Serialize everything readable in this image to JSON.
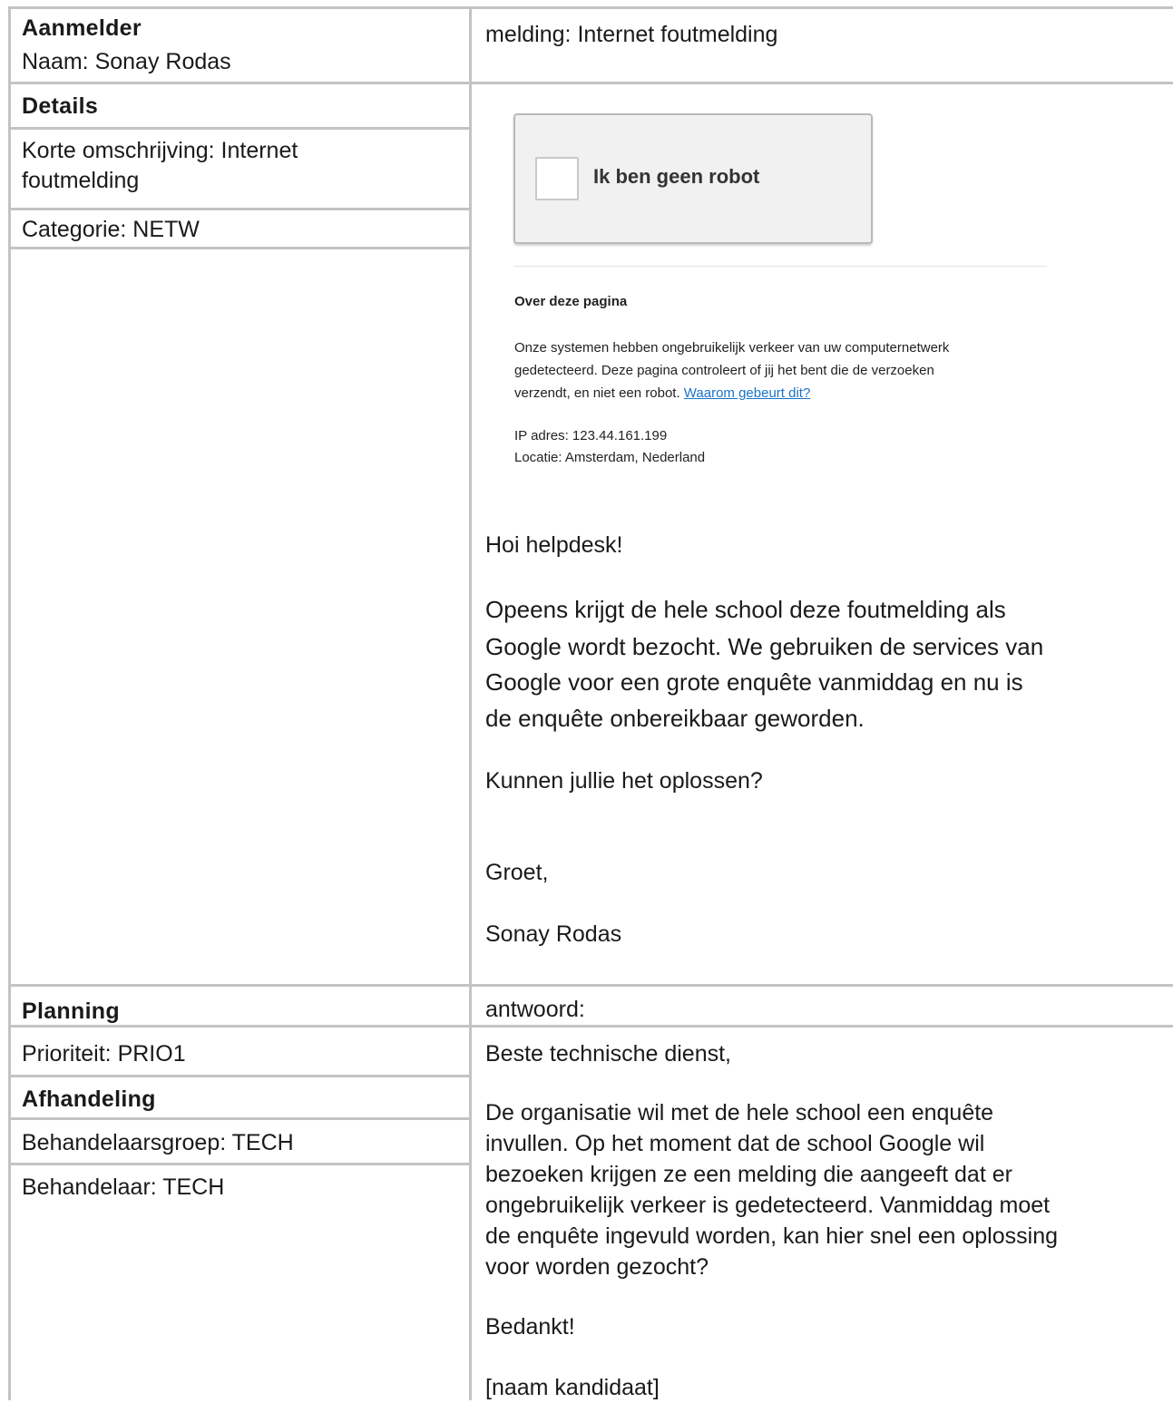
{
  "reporter": {
    "heading": "Aanmelder",
    "name_line": "Naam: Sonay Rodas"
  },
  "ticket": {
    "subject": "melding: Internet foutmelding"
  },
  "details": {
    "heading": "Details",
    "short_description": "Korte omschrijving: Internet foutmelding",
    "category": "Categorie: NETW"
  },
  "screenshot": {
    "checkbox_label": "Ik ben geen robot",
    "about_heading": "Over deze pagina",
    "about_line1": "Onze systemen hebben ongebruikelijk verkeer van uw computernetwerk",
    "about_line2": "gedetecteerd. Deze pagina controleert of jij het bent die de verzoeken",
    "about_line3": "verzendt, en niet een robot.",
    "about_link": "Waarom gebeurt dit?",
    "ip": "IP adres: 123.44.161.199",
    "location": "Locatie: Amsterdam, Nederland"
  },
  "message": {
    "greeting": "Hoi helpdesk!",
    "body_l1": "Opeens krijgt de hele school deze foutmelding als",
    "body_l2": "Google wordt bezocht. We gebruiken de services van",
    "body_l3": "Google voor een grote enquête vanmiddag en nu is",
    "body_l4": "de enquête onbereikbaar geworden.",
    "question": "Kunnen jullie het oplossen?",
    "closing": "Groet,",
    "signature": "Sonay Rodas"
  },
  "planning": {
    "heading": "Planning",
    "priority": "Prioriteit: PRIO1"
  },
  "handling": {
    "heading": "Afhandeling",
    "group": "Behandelaarsgroep: TECH",
    "handler": "Behandelaar: TECH"
  },
  "answer": {
    "label": "antwoord:",
    "salutation": "Beste technische dienst,",
    "body_l1": "De organisatie wil met de hele school een enquête",
    "body_l2": "invullen. Op het moment dat de school Google wil",
    "body_l3": "bezoeken krijgen ze een melding die aangeeft dat er",
    "body_l4": "ongebruikelijk verkeer is gedetecteerd. Vanmiddag moet",
    "body_l5": "de enquête ingevuld worden, kan hier snel een oplossing",
    "body_l6": "voor worden gezocht?",
    "thanks": "Bedankt!",
    "signature": "[naam kandidaat]"
  }
}
